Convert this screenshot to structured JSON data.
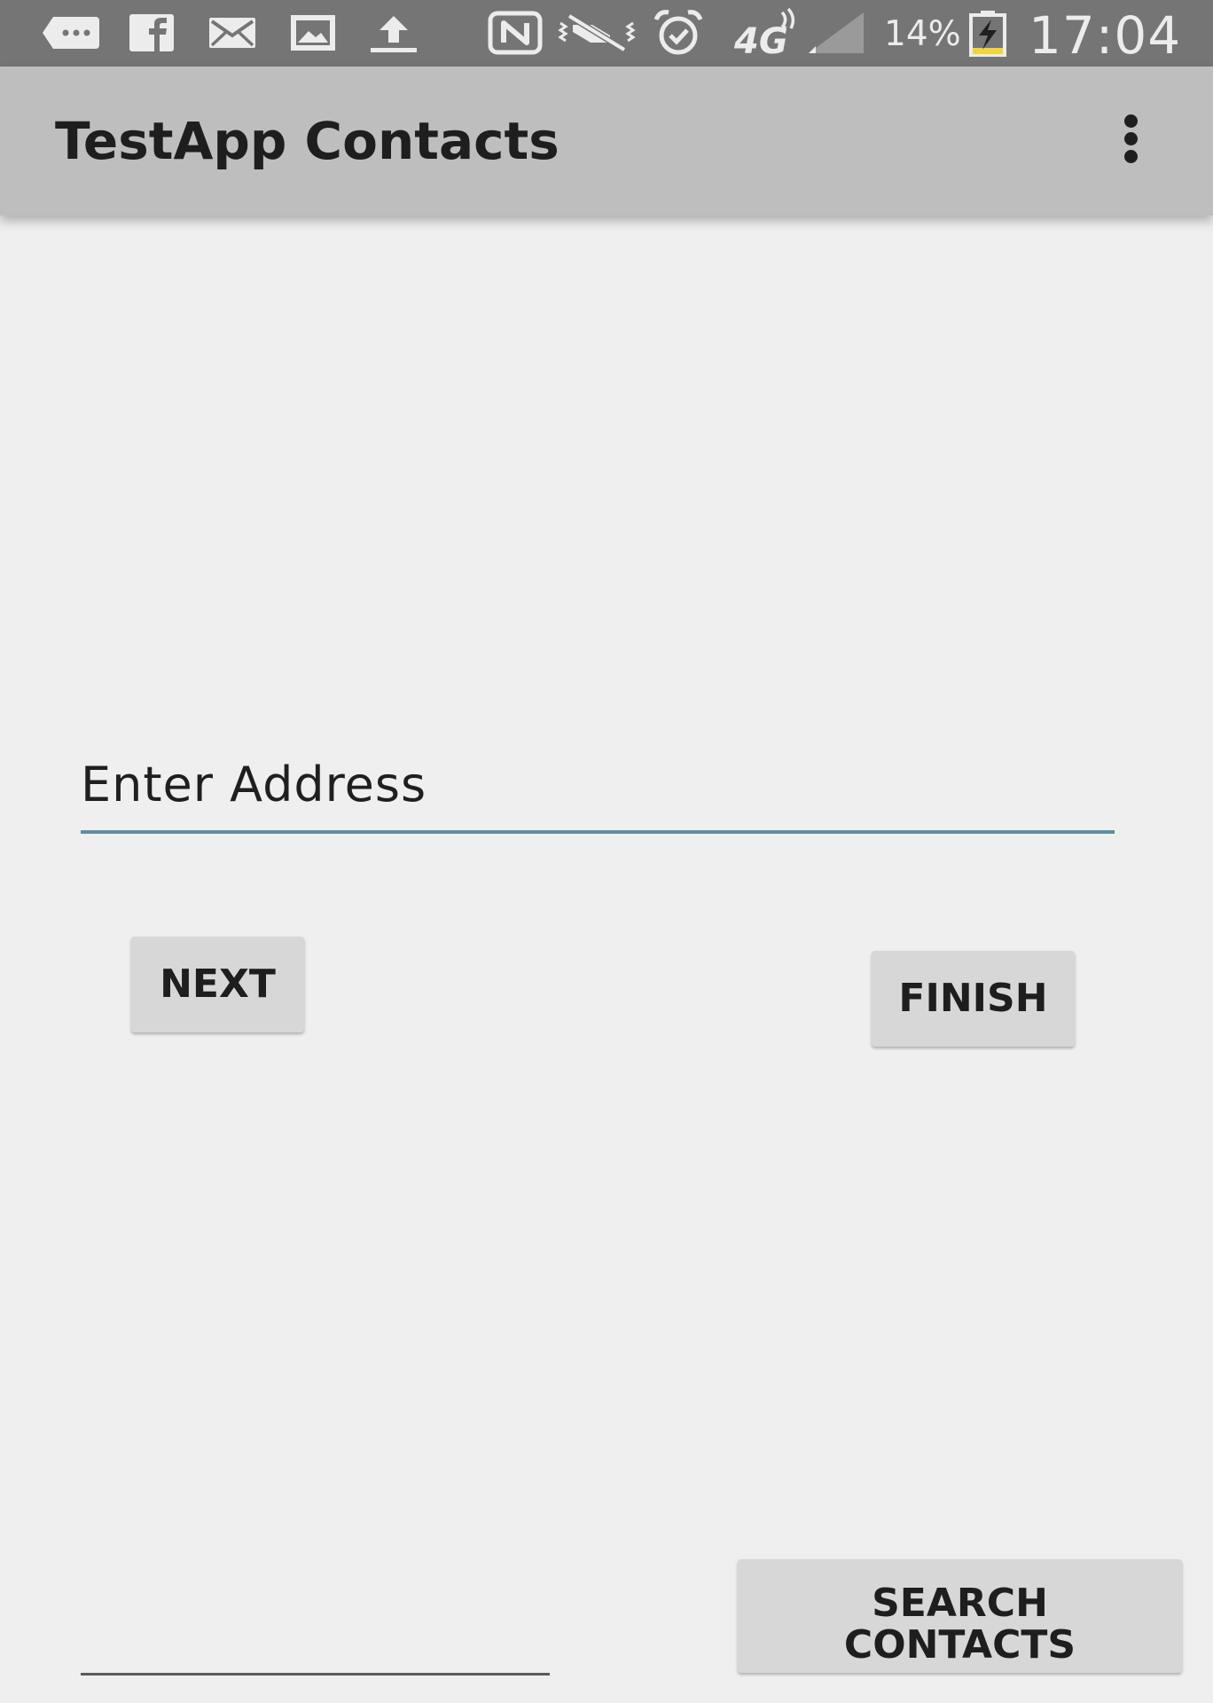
{
  "status_bar": {
    "icons": [
      "message-icon",
      "facebook-icon",
      "email-icon",
      "gallery-icon",
      "upload-icon",
      "nfc-icon",
      "vibrate-mute-icon",
      "alarm-icon",
      "network-4g-icon",
      "signal-icon",
      "battery-charging-icon"
    ],
    "network_type": "4G",
    "battery_percent": "14%",
    "time": "17:04"
  },
  "app_bar": {
    "title": "TestApp Contacts",
    "menu_icon": "overflow-menu-icon"
  },
  "form": {
    "address_placeholder": "Enter Address",
    "address_value": "",
    "next_label": "NEXT",
    "finish_label": "FINISH",
    "search_label_line1": "SEARCH",
    "search_label_line2": "CONTACTS",
    "bottom_field_value": ""
  },
  "colors": {
    "status_bar": "#757575",
    "app_bar": "#bebebe",
    "background": "#efefef",
    "button": "#d7d7d7",
    "accent_underline": "#5d8ea0",
    "battery_level": "#f2d43c"
  }
}
